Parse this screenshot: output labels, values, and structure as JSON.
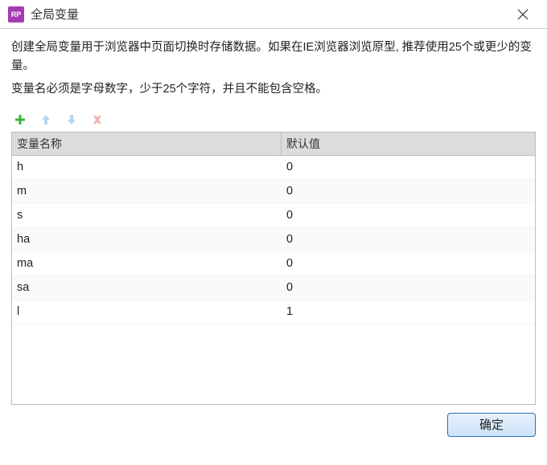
{
  "window": {
    "app_icon_text": "RP",
    "title": "全局变量"
  },
  "description": {
    "line1": "创建全局变量用于浏览器中页面切换时存储数据。如果在IE浏览器浏览原型, 推荐使用25个或更少的变量。",
    "line2": "变量名必须是字母数字，少于25个字符，并且不能包含空格。"
  },
  "toolbar": {
    "icons": {
      "add": "add-icon",
      "up": "arrow-up-icon",
      "down": "arrow-down-icon",
      "delete": "delete-icon"
    },
    "colors": {
      "add": "#3fb23f",
      "up": "#b8d4ef",
      "down": "#b8d4ef",
      "delete": "#f1b3b3"
    }
  },
  "table": {
    "headers": {
      "name": "变量名称",
      "default": "默认值"
    },
    "rows": [
      {
        "name": "h",
        "default": "0"
      },
      {
        "name": "m",
        "default": "0"
      },
      {
        "name": "s",
        "default": "0"
      },
      {
        "name": "ha",
        "default": "0"
      },
      {
        "name": "ma",
        "default": "0"
      },
      {
        "name": "sa",
        "default": "0"
      },
      {
        "name": "l",
        "default": "1"
      }
    ]
  },
  "footer": {
    "ok_label": "确定"
  }
}
